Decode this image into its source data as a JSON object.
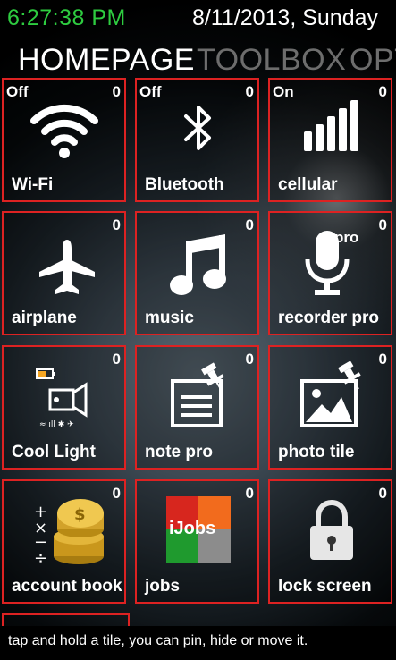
{
  "status": {
    "time": "6:27:38 PM",
    "date": "8/11/2013, Sunday",
    "time_color": "#2ecc40"
  },
  "pivot": [
    "HOMEPAGE",
    "TOOLBOX",
    "OPT"
  ],
  "accent_color": "#dd2222",
  "tiles": [
    {
      "label": "Wi-Fi",
      "state": "Off",
      "count": "0",
      "icon": "wifi-icon"
    },
    {
      "label": "Bluetooth",
      "state": "Off",
      "count": "0",
      "icon": "bluetooth-icon"
    },
    {
      "label": "cellular",
      "state": "On",
      "count": "0",
      "icon": "signal-bars-icon"
    },
    {
      "label": "airplane",
      "state": "",
      "count": "0",
      "icon": "airplane-icon"
    },
    {
      "label": "music",
      "state": "",
      "count": "0",
      "icon": "music-note-icon"
    },
    {
      "label": "recorder pro",
      "state": "",
      "count": "0",
      "icon": "microphone-icon",
      "badge": "pro"
    },
    {
      "label": "Cool Light",
      "state": "",
      "count": "0",
      "icon": "flashlight-icon"
    },
    {
      "label": "note pro",
      "state": "",
      "count": "0",
      "icon": "pinned-note-icon"
    },
    {
      "label": "photo tile",
      "state": "",
      "count": "0",
      "icon": "pinned-photo-icon"
    },
    {
      "label": "account book",
      "state": "",
      "count": "0",
      "icon": "coins-calculator-icon"
    },
    {
      "label": "jobs",
      "state": "",
      "count": "0",
      "icon": "ijobs-logo-icon",
      "logo_text": "iJobs"
    },
    {
      "label": "lock screen",
      "state": "",
      "count": "0",
      "icon": "padlock-icon"
    }
  ],
  "hint": "tap and hold a tile, you can pin, hide or move it."
}
